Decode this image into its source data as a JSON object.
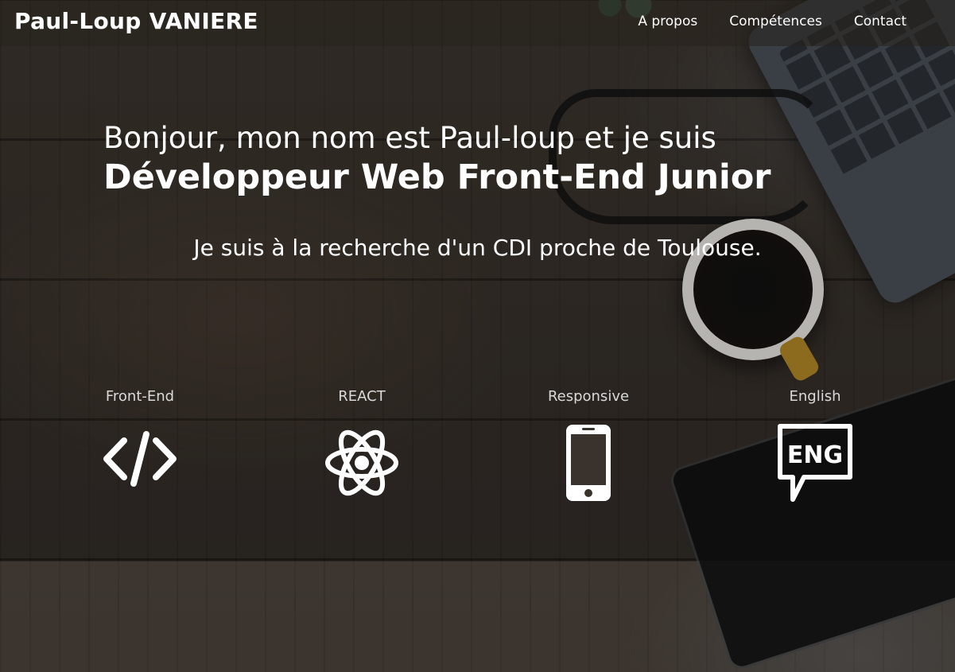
{
  "nav": {
    "brand": "Paul-Loup VANIERE",
    "items": [
      {
        "label": "A propos"
      },
      {
        "label": "Compétences"
      },
      {
        "label": "Contact"
      }
    ]
  },
  "hero": {
    "intro": "Bonjour, mon nom est Paul-loup et je suis",
    "role": "Développeur Web Front-End Junior",
    "tagline": "Je suis à la recherche d'un CDI proche de Toulouse."
  },
  "skills": [
    {
      "label": "Front-End",
      "icon": "code-icon"
    },
    {
      "label": "REACT",
      "icon": "atom-icon"
    },
    {
      "label": "Responsive",
      "icon": "smartphone-icon"
    },
    {
      "label": "English",
      "icon": "eng-speech-bubble-icon",
      "icon_text": "ENG"
    }
  ],
  "colors": {
    "text": "#ffffff",
    "label": "#d9d9d9",
    "nav_bg": "rgba(40,34,30,0.55)"
  }
}
